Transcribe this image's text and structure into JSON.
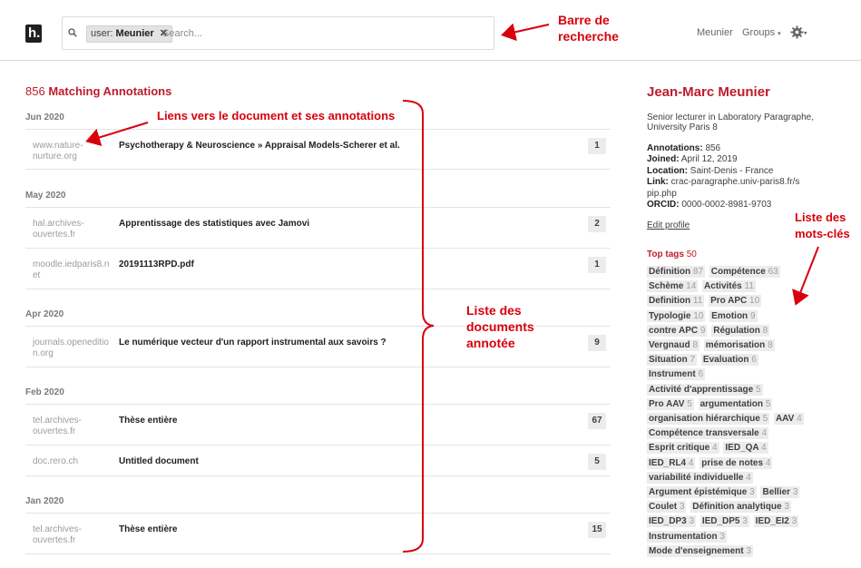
{
  "header": {
    "logo": "h.",
    "search_facet_key": "user:",
    "search_facet_value": "Meunier",
    "search_placeholder": "Search...",
    "nav_user": "Meunier",
    "nav_groups": "Groups",
    "nav_caret": "▾",
    "settings_icon": "gear-icon"
  },
  "results": {
    "count": "856",
    "label": "Matching Annotations",
    "groups": [
      {
        "month": "Jun 2020",
        "items": [
          {
            "domain": "www.nature-nurture.org",
            "title": "Psychotherapy & Neuroscience » Appraisal Models-Scherer et al.",
            "count": "1"
          }
        ]
      },
      {
        "month": "May 2020",
        "items": [
          {
            "domain": "hal.archives-ouvertes.fr",
            "title": "Apprentissage des statistiques avec Jamovi",
            "count": "2"
          },
          {
            "domain": "moodle.iedparis8.net",
            "title": "20191113RPD.pdf",
            "count": "1"
          }
        ]
      },
      {
        "month": "Apr 2020",
        "items": [
          {
            "domain": "journals.openedition.org",
            "title": "Le numérique vecteur d'un rapport instrumental aux savoirs ?",
            "count": "9"
          }
        ]
      },
      {
        "month": "Feb 2020",
        "items": [
          {
            "domain": "tel.archives-ouvertes.fr",
            "title": "Thèse entière",
            "count": "67"
          },
          {
            "domain": "doc.rero.ch",
            "title": "Untitled document",
            "count": "5"
          }
        ]
      },
      {
        "month": "Jan 2020",
        "items": [
          {
            "domain": "tel.archives-ouvertes.fr",
            "title": "Thèse entière",
            "count": "15"
          }
        ]
      }
    ]
  },
  "profile": {
    "name": "Jean-Marc Meunier",
    "bio": "Senior lecturer in Laboratory Paragraphe, University Paris 8",
    "annotations_label": "Annotations:",
    "annotations": "856",
    "joined_label": "Joined:",
    "joined": "April 12, 2019",
    "location_label": "Location:",
    "location": "Saint-Denis - France",
    "link_label": "Link:",
    "link": "crac-paragraphe.univ-paris8.fr/spip.php",
    "orcid_label": "ORCID:",
    "orcid": "0000-0002-8981-9703",
    "edit": "Edit profile",
    "top_tags_label": "Top tags",
    "top_tags_count": "50",
    "tags": [
      [
        "Définition",
        "87"
      ],
      [
        "Compétence",
        "63"
      ],
      [
        "Schème",
        "14"
      ],
      [
        "Activités",
        "11"
      ],
      [
        "Definition",
        "11"
      ],
      [
        "Pro APC",
        "10"
      ],
      [
        "Typologie",
        "10"
      ],
      [
        "Emotion",
        "9"
      ],
      [
        "contre APC",
        "9"
      ],
      [
        "Régulation",
        "8"
      ],
      [
        "Vergnaud",
        "8"
      ],
      [
        "mémorisation",
        "8"
      ],
      [
        "Situation",
        "7"
      ],
      [
        "Evaluation",
        "6"
      ],
      [
        "Instrument",
        "6"
      ],
      [
        "Activité d'apprentissage",
        "5"
      ],
      [
        "Pro AAV",
        "5"
      ],
      [
        "argumentation",
        "5"
      ],
      [
        "organisation hiérarchique",
        "5"
      ],
      [
        "AAV",
        "4"
      ],
      [
        "Compétence transversale",
        "4"
      ],
      [
        "Esprit critique",
        "4"
      ],
      [
        "IED_QA",
        "4"
      ],
      [
        "IED_RL4",
        "4"
      ],
      [
        "prise de notes",
        "4"
      ],
      [
        "variabilité individuelle",
        "4"
      ],
      [
        "Argument épistémique",
        "3"
      ],
      [
        "Bellier",
        "3"
      ],
      [
        "Coulet",
        "3"
      ],
      [
        "Définition analytique",
        "3"
      ],
      [
        "IED_DP3",
        "3"
      ],
      [
        "IED_DP5",
        "3"
      ],
      [
        "IED_EI2",
        "3"
      ],
      [
        "Instrumentation",
        "3"
      ],
      [
        "Mode d'enseignement",
        "3"
      ]
    ]
  },
  "annotations_overlay": {
    "search_bar": [
      "Barre de",
      "recherche"
    ],
    "links": "Liens vers le document et ses annotations",
    "doc_list": [
      "Liste des",
      "documents",
      "annotée"
    ],
    "keyword_list": [
      "Liste des",
      "mots-clés"
    ],
    "color": "#d8000d"
  }
}
